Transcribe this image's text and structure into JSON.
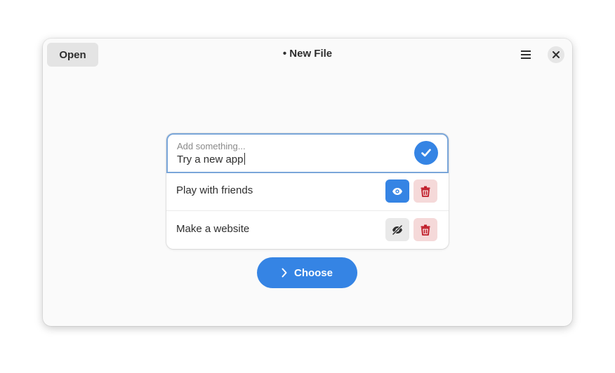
{
  "header": {
    "open_label": "Open",
    "title": "• New File",
    "menu_icon": "hamburger-menu-icon",
    "close_icon": "close-icon"
  },
  "entry": {
    "placeholder": "Add something...",
    "value": "Try a new app",
    "confirm_icon": "checkmark-icon"
  },
  "tasks": [
    {
      "label": "Play with friends",
      "visibility_icon": "eye-icon",
      "visible": true,
      "delete_icon": "trash-icon"
    },
    {
      "label": "Make a website",
      "visibility_icon": "eye-slash-icon",
      "visible": false,
      "delete_icon": "trash-icon"
    }
  ],
  "choose_button": {
    "label": "Choose",
    "icon": "chevron-right-icon"
  },
  "colors": {
    "accent": "#3584e4",
    "destructive": "#c01c28",
    "destructive_bg": "#f5d9d9",
    "window_bg": "#fafafa"
  }
}
